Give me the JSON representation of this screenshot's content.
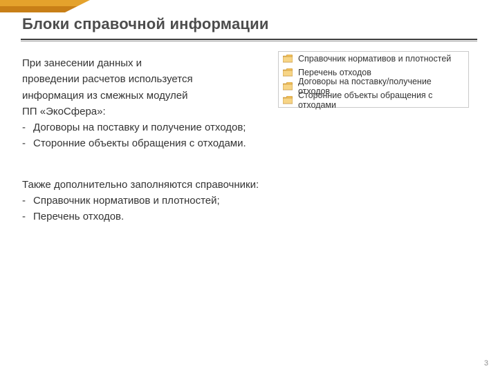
{
  "title": "Блоки справочной информации",
  "intro": {
    "l1": "При занесении данных и",
    "l2": "проведении расчетов используется",
    "l3": "информация из смежных модулей",
    "l4": "ПП «ЭкоСфера»:"
  },
  "list1": [
    "Договоры на поставку и получение отходов;",
    "Сторонние объекты обращения с отходами."
  ],
  "para2": "Также дополнительно заполняются справочники:",
  "list2": [
    "Справочник нормативов и плотностей;",
    "Перечень отходов."
  ],
  "panel": {
    "items": [
      "Справочник нормативов и плотностей",
      "Перечень отходов",
      "Договоры на поставку/получение отходов",
      "Сторонние объекты обращения с отходами"
    ]
  },
  "page_number": "3"
}
